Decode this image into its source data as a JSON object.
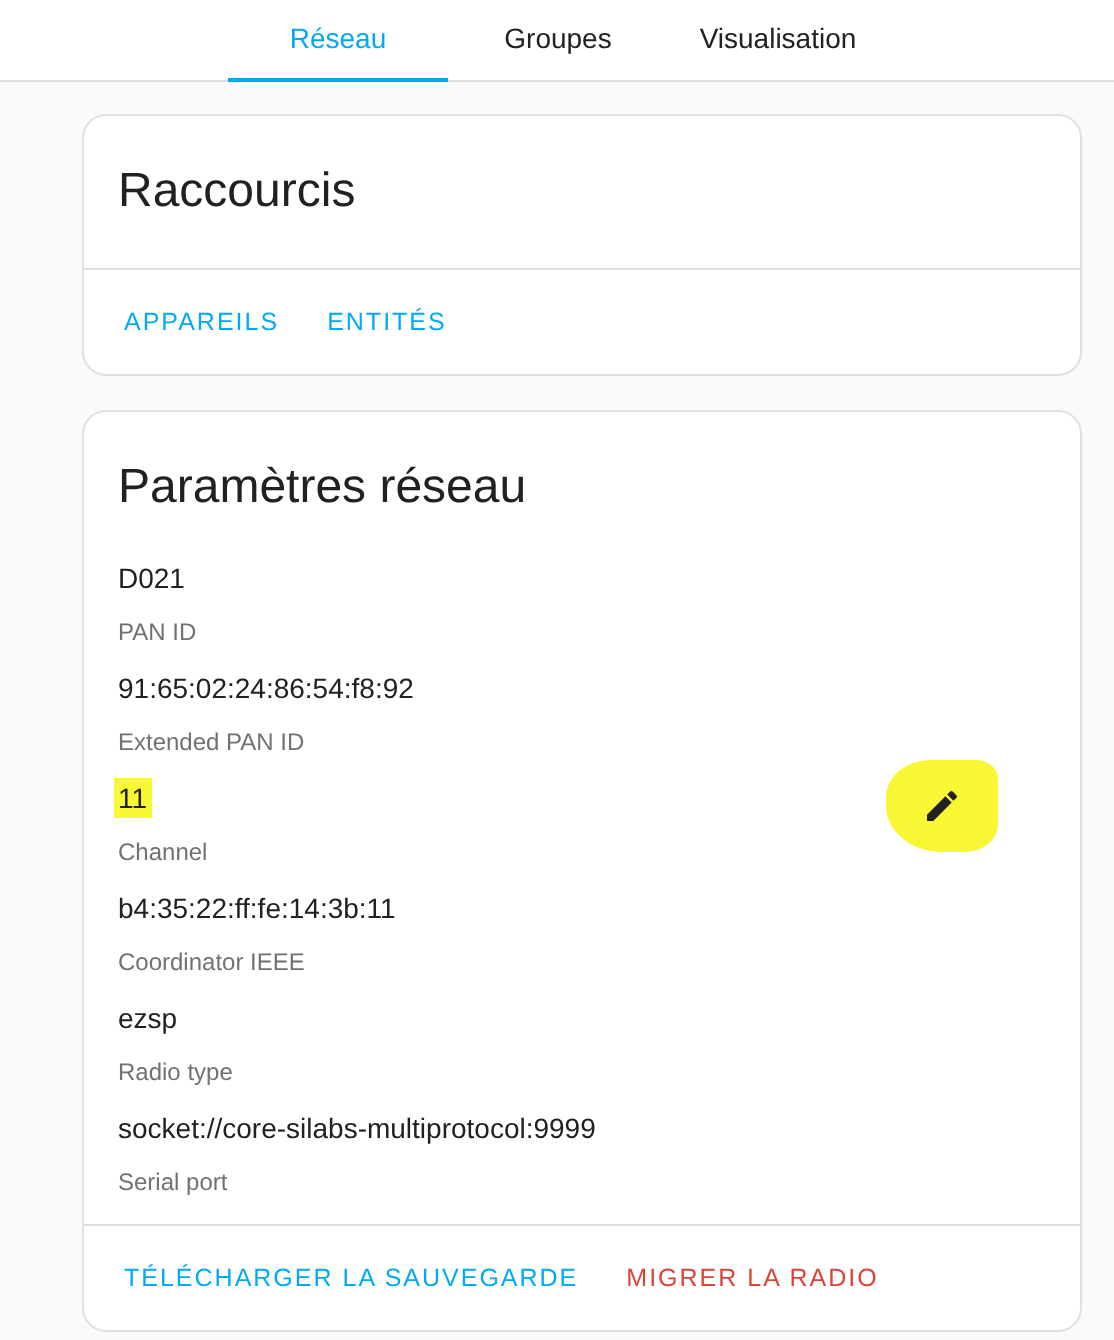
{
  "tabs": [
    {
      "label": "Réseau",
      "selected": true
    },
    {
      "label": "Groupes",
      "selected": false
    },
    {
      "label": "Visualisation",
      "selected": false
    }
  ],
  "shortcuts": {
    "title": "Raccourcis",
    "actions": [
      "APPAREILS",
      "ENTITÉS"
    ]
  },
  "network": {
    "title": "Paramètres réseau",
    "fields": [
      {
        "value": "D021",
        "label": "PAN ID",
        "highlighted": false,
        "editable": false
      },
      {
        "value": "91:65:02:24:86:54:f8:92",
        "label": "Extended PAN ID",
        "highlighted": false,
        "editable": false
      },
      {
        "value": "11",
        "label": "Channel",
        "highlighted": true,
        "editable": true
      },
      {
        "value": "b4:35:22:ff:fe:14:3b:11",
        "label": "Coordinator IEEE",
        "highlighted": false,
        "editable": false
      },
      {
        "value": "ezsp",
        "label": "Radio type",
        "highlighted": false,
        "editable": false
      },
      {
        "value": "socket://core-silabs-multiprotocol:9999",
        "label": "Serial port",
        "highlighted": false,
        "editable": false
      }
    ],
    "actions": [
      {
        "label": "TÉLÉCHARGER LA SAUVEGARDE",
        "kind": "primary"
      },
      {
        "label": "MIGRER LA RADIO",
        "kind": "danger"
      }
    ]
  }
}
